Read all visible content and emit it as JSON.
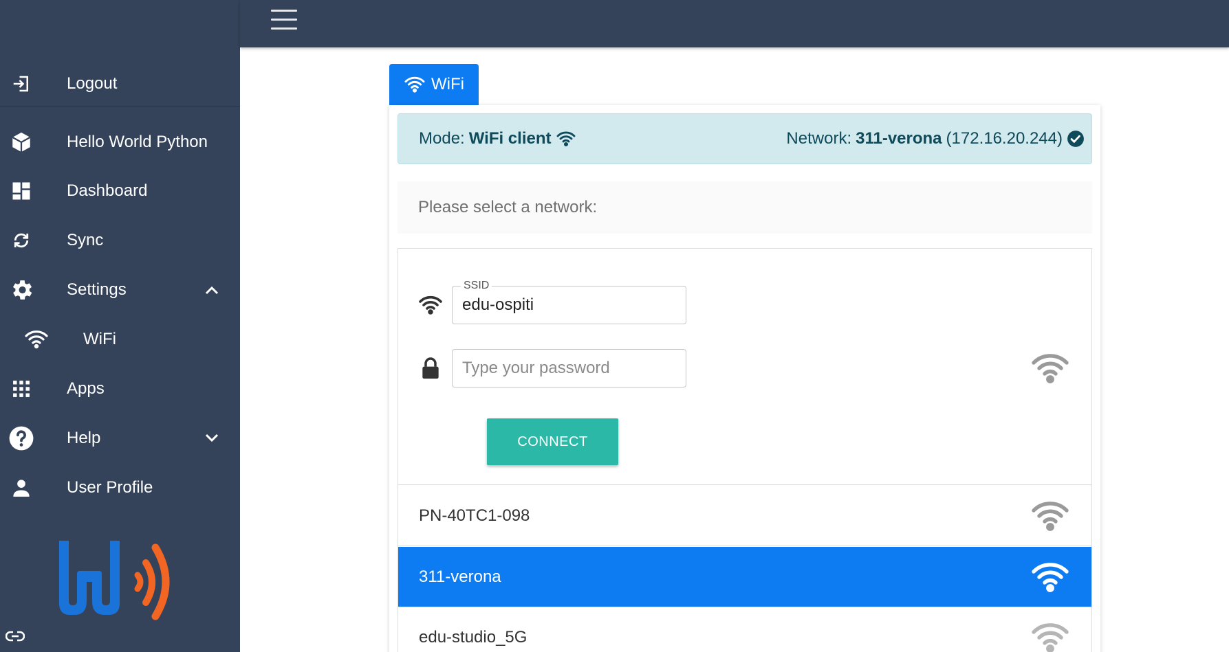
{
  "sidebar": {
    "items": [
      {
        "label": "Logout",
        "icon": "logout-icon"
      },
      {
        "label": "Hello World Python",
        "icon": "cube-icon"
      },
      {
        "label": "Dashboard",
        "icon": "dashboard-icon"
      },
      {
        "label": "Sync",
        "icon": "sync-icon"
      },
      {
        "label": "Settings",
        "icon": "gear-icon",
        "expanded": true
      },
      {
        "label": "WiFi",
        "icon": "wifi-icon",
        "sub": true
      },
      {
        "label": "Apps",
        "icon": "apps-grid-icon"
      },
      {
        "label": "Help",
        "icon": "help-icon",
        "expanded": false
      },
      {
        "label": "User Profile",
        "icon": "user-icon"
      }
    ],
    "colors": {
      "background": "#34435a",
      "logo_blue": "#1a73d9",
      "logo_orange": "#f26522"
    }
  },
  "tab": {
    "label": "WiFi"
  },
  "status": {
    "mode_label": "Mode:",
    "mode_value": "WiFi client",
    "network_label": "Network:",
    "network_name": "311-verona",
    "network_ip": "(172.16.20.244)"
  },
  "select_prompt": "Please select a network:",
  "form": {
    "ssid_label": "SSID",
    "ssid_value": "edu-ospiti",
    "password_placeholder": "Type your password",
    "connect_label": "CONNECT"
  },
  "networks": [
    {
      "name": "PN-40TC1-098",
      "selected": false
    },
    {
      "name": "311-verona",
      "selected": true
    },
    {
      "name": "edu-studio_5G",
      "selected": false
    }
  ],
  "colors": {
    "primary": "#0d7cf2",
    "success": "#2bb8a6",
    "alert_bg": "#d2e9ee",
    "alert_text": "#0e4a5a"
  }
}
